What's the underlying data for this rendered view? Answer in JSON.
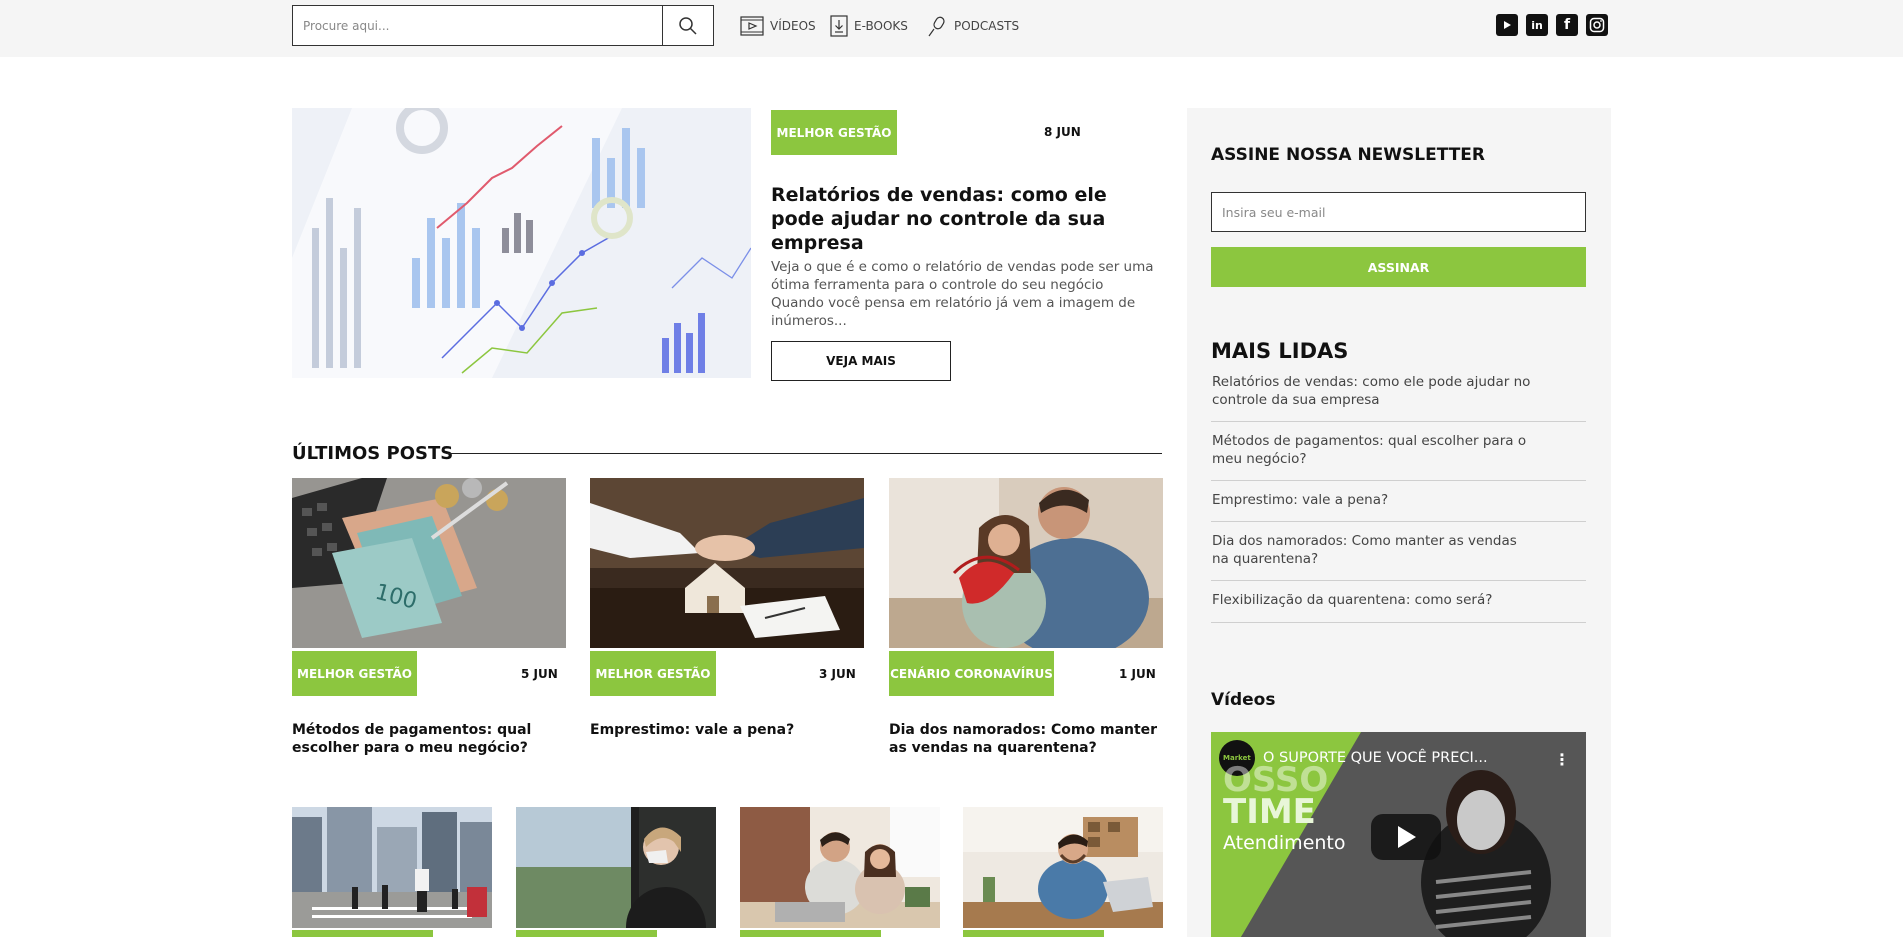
{
  "header": {
    "search_placeholder": "Procure aqui...",
    "nav": [
      {
        "label": "VÍDEOS",
        "icon": "video-icon"
      },
      {
        "label": "E-BOOKS",
        "icon": "download-icon"
      },
      {
        "label": "PODCASTS",
        "icon": "microphone-icon"
      }
    ],
    "social": [
      "youtube-icon",
      "linkedin-icon",
      "facebook-icon",
      "instagram-icon"
    ]
  },
  "featured": {
    "tag": "MELHOR GESTÃO",
    "date": "8 JUN",
    "title": "Relatórios de vendas: como ele pode ajudar no controle da sua empresa",
    "excerpt": "Veja o que é e como o relatório de vendas pode ser uma ótima ferramenta para o controle do seu negócio Quando você pensa em relatório já vem a imagem de inúmeros...",
    "button": "VEJA MAIS"
  },
  "latest": {
    "title": "ÚLTIMOS POSTS",
    "posts": [
      {
        "tag": "MELHOR GESTÃO",
        "date": "5 JUN",
        "title": "Métodos de pagamentos: qual escolher para o meu negócio?"
      },
      {
        "tag": "MELHOR GESTÃO",
        "date": "3 JUN",
        "title": "Emprestimo: vale a pena?"
      },
      {
        "tag": "CENÁRIO CORONAVÍRUS",
        "date": "1 JUN",
        "title": "Dia dos namorados: Como manter as vendas na quarentena?"
      }
    ]
  },
  "sidebar": {
    "newsletter_title": "ASSINE NOSSA NEWSLETTER",
    "email_placeholder": "Insira seu e-mail",
    "subscribe": "ASSINAR",
    "most_read_title": "MAIS LIDAS",
    "most_read": [
      "Relatórios de vendas: como ele pode ajudar no controle da sua empresa",
      "Métodos de pagamentos: qual escolher para o meu negócio?",
      "Emprestimo: vale a pena?",
      "Dia dos namorados: Como manter as vendas na quarentena?",
      "Flexibilização da quarentena: como será?"
    ],
    "videos_title": "Vídeos",
    "video": {
      "channel_badge": "Market",
      "title": "O SUPORTE QUE VOCÊ PRECI...",
      "overlay_line1": "OSSO",
      "overlay_line2": "TIME",
      "overlay_line3": "Atendimento"
    }
  },
  "colors": {
    "accent": "#8cc63f",
    "sidebar_bg": "#f5f5f5",
    "topbar_bg": "#f5f5f5"
  }
}
